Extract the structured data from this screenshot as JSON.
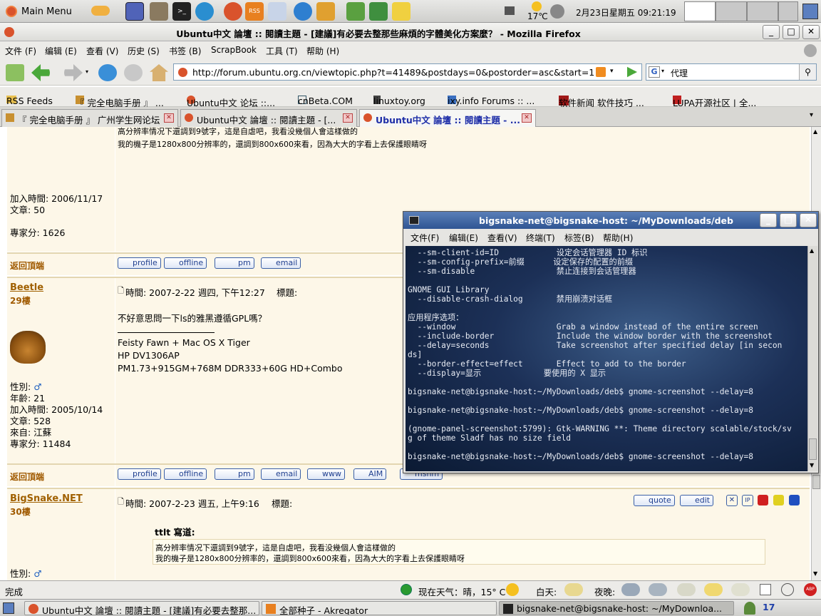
{
  "top_panel": {
    "main_menu": "Main Menu",
    "temp": "17℃",
    "datetime": "2月23日星期五 09:21:19"
  },
  "window": {
    "title": "Ubuntu中文 論壇 :: 閱讀主題 - [建議]有必要去整那些麻煩的字體美化方案麼？ - Mozilla Firefox"
  },
  "menu": [
    "文件 (F)",
    "编辑 (E)",
    "查看 (V)",
    "历史 (S)",
    "书签 (B)",
    "ScrapBook",
    "工具 (T)",
    "帮助 (H)"
  ],
  "url": "http://forum.ubuntu.org.cn/viewtopic.php?t=41489&postdays=0&postorder=asc&start=1",
  "search_value": "代理",
  "bookmarks": [
    "RSS Feeds",
    "『 完全电脑手册 』 ...",
    "Ubuntu中文 论坛 ::...",
    "cnBeta.COM",
    "linuxtoy.org",
    "ixy.info Forums :: ...",
    "软件新闻 软件技巧 ...",
    "LUPA开源社区 | 全..."
  ],
  "tabs": [
    "『 完全电脑手册 』 广州学生网论坛",
    "Ubuntu中文 論壇 :: 閱讀主題 - [...",
    "Ubuntu中文 論壇 :: 閱讀主題 - ..."
  ],
  "post1": {
    "line1": "高分辨率情况下還調到9號字，這是自虐吧，我看没幾個人會這樣做的",
    "line2": "我的機子是1280x800分辨率的，還調到800x600來看，因為大大的字看上去保護眼睛呀",
    "joined": "加入時間: 2006/11/17",
    "posts": "文章: 50",
    "score": "專家分: 1626",
    "back_top": "返回頂端"
  },
  "post2": {
    "user": "Beetle",
    "floor": "29樓",
    "time": "時間: 2007-2-22 週四, 下午12:27",
    "subject": "標題:",
    "body": "不好意思問一下ls的雅黑遵循GPL嗎？",
    "sig1": "Feisty Fawn + Mac OS X Tiger",
    "sig2": "HP DV1306AP",
    "sig3": "PM1.73+915GM+768M DDR333+60G HD+Combo",
    "gender": "性別:",
    "age": "年齡: 21",
    "joined": "加入時間: 2005/10/14",
    "posts": "文章: 528",
    "from": "來自: 江蘇",
    "score": "專家分: 11484",
    "back_top": "返回頂端"
  },
  "post3": {
    "user": "BigSnake.NET",
    "floor": "30樓",
    "time": "時間: 2007-2-23 週五, 上午9:16",
    "subject": "標題:",
    "quote_by": "ttlt 寫道:",
    "quote1": "高分辨率情况下還調到9號字，這是自虐吧，我看没幾個人會這樣做的",
    "quote2": "我的機子是1280x800分辨率的，還調到800x600來看，因為大大的字看上去保護眼睛呀",
    "gender": "性別:"
  },
  "buttons": {
    "profile": "profile",
    "offline": "offline",
    "pm": "pm",
    "email": "email",
    "www": "www",
    "aim": "AIM",
    "msnm": "msnm",
    "quote": "quote",
    "edit": "edit",
    "ip": "IP"
  },
  "terminal": {
    "title": "bigsnake-net@bigsnake-host: ~/MyDownloads/deb",
    "menu": [
      "文件(F)",
      "编辑(E)",
      "查看(V)",
      "终端(T)",
      "标签(B)",
      "帮助(H)"
    ],
    "lines": [
      "  --sm-client-id=ID            设定会话管理器 ID 标识",
      "  --sm-config-prefix=前缀      设定保存的配置的前缀",
      "  --sm-disable                 禁止连接到会话管理器",
      "",
      "GNOME GUI Library",
      "  --disable-crash-dialog       禁用崩溃对话框",
      "",
      "应用程序选项：",
      "  --window                     Grab a window instead of the entire screen",
      "  --include-border             Include the window border with the screenshot",
      "  --delay=seconds              Take screenshot after specified delay [in secon",
      "ds]",
      "  --border-effect=effect       Effect to add to the border",
      "  --display=显示             要使用的 X 显示",
      "",
      "bigsnake-net@bigsnake-host:~/MyDownloads/deb$ gnome-screenshot --delay=8",
      "",
      "bigsnake-net@bigsnake-host:~/MyDownloads/deb$ gnome-screenshot --delay=8",
      "",
      "(gnome-panel-screenshot:5799): Gtk-WARNING **: Theme directory scalable/stock/sv",
      "g of theme Sladf has no size field",
      "",
      "bigsnake-net@bigsnake-host:~/MyDownloads/deb$ gnome-screenshot --delay=8"
    ]
  },
  "status": {
    "done": "完成",
    "weather_now": "现在天气：晴，15° C",
    "day": "白天:",
    "night": "夜晚:",
    "abp": "ABP"
  },
  "taskbar": [
    "Ubuntu中文 論壇 :: 閱讀主題 - [建議]有必要去整那...",
    "全部种子 - Akregator",
    "bigsnake-net@bigsnake-host: ~/MyDownloa..."
  ],
  "taskbar_count": "17"
}
